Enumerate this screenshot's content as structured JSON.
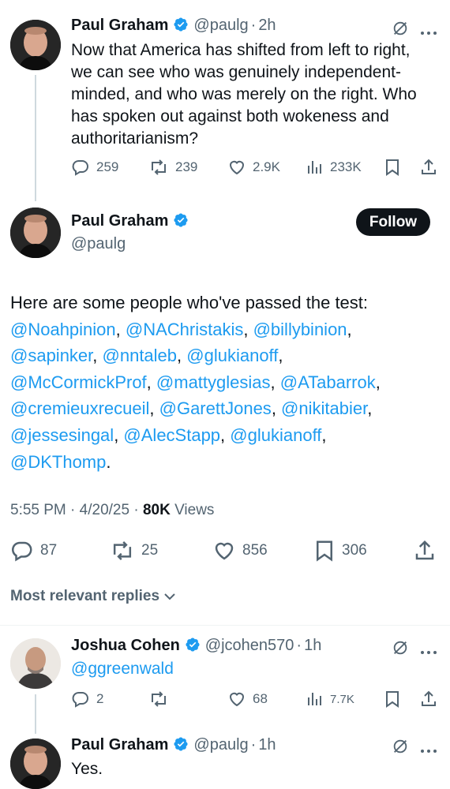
{
  "top_tweet": {
    "name": "Paul Graham",
    "handle": "@paulg",
    "sep": "·",
    "time": "2h",
    "text_lines": [
      "Now that America has shifted from left to right,",
      "we can see who was genuinely independent-",
      "minded, and who was merely on the right. Who",
      "has spoken out against both wokeness and",
      "authoritarianism?"
    ],
    "replies": "259",
    "reposts": "239",
    "likes": "2.9K",
    "views": "233K"
  },
  "main_tweet": {
    "name": "Paul Graham",
    "handle": "@paulg",
    "follow_label": "Follow",
    "intro": "Here are some people who've passed the test:",
    "lines": [
      [
        {
          "t": "@Noahpinion",
          "l": true
        },
        {
          "t": ", ",
          "l": false
        },
        {
          "t": "@NAChristakis",
          "l": true
        },
        {
          "t": ", ",
          "l": false
        },
        {
          "t": "@billybinion",
          "l": true
        },
        {
          "t": ",",
          "l": false
        }
      ],
      [
        {
          "t": "@sapinker",
          "l": true
        },
        {
          "t": ", ",
          "l": false
        },
        {
          "t": "@nntaleb",
          "l": true
        },
        {
          "t": ", ",
          "l": false
        },
        {
          "t": "@glukianoff",
          "l": true
        },
        {
          "t": ",",
          "l": false
        }
      ],
      [
        {
          "t": "@McCormickProf",
          "l": true
        },
        {
          "t": ", ",
          "l": false
        },
        {
          "t": "@mattyglesias",
          "l": true
        },
        {
          "t": ", ",
          "l": false
        },
        {
          "t": "@ATabarrok",
          "l": true
        },
        {
          "t": ",",
          "l": false
        }
      ],
      [
        {
          "t": "@cremieuxrecueil",
          "l": true
        },
        {
          "t": ", ",
          "l": false
        },
        {
          "t": "@GarettJones",
          "l": true
        },
        {
          "t": ", ",
          "l": false
        },
        {
          "t": "@nikitabier",
          "l": true
        },
        {
          "t": ",",
          "l": false
        }
      ],
      [
        {
          "t": "@jessesingal",
          "l": true
        },
        {
          "t": ", ",
          "l": false
        },
        {
          "t": "@AlecStapp",
          "l": true
        },
        {
          "t": ", ",
          "l": false
        },
        {
          "t": "@glukianoff",
          "l": true
        },
        {
          "t": ",",
          "l": false
        }
      ],
      [
        {
          "t": "@DKThomp",
          "l": true
        },
        {
          "t": ".",
          "l": false
        }
      ]
    ],
    "time": "5:55 PM",
    "date": "4/20/25",
    "views_count": "80K",
    "views_label": "Views",
    "replies": "87",
    "reposts": "25",
    "likes": "856",
    "bookmarks": "306"
  },
  "sort_label": "Most relevant replies",
  "reply1": {
    "name": "Joshua Cohen",
    "handle": "@jcohen570",
    "sep": "·",
    "time": "1h",
    "text": "@ggreenwald",
    "replies": "2",
    "likes": "68",
    "views": "7.7K"
  },
  "reply2": {
    "name": "Paul Graham",
    "handle": "@paulg",
    "sep": "·",
    "time": "1h",
    "text": "Yes."
  },
  "colors": {
    "link": "#1d9bf0",
    "verified": "#1d9bf0",
    "secondary_text": "#536471",
    "text": "#0f1419"
  }
}
